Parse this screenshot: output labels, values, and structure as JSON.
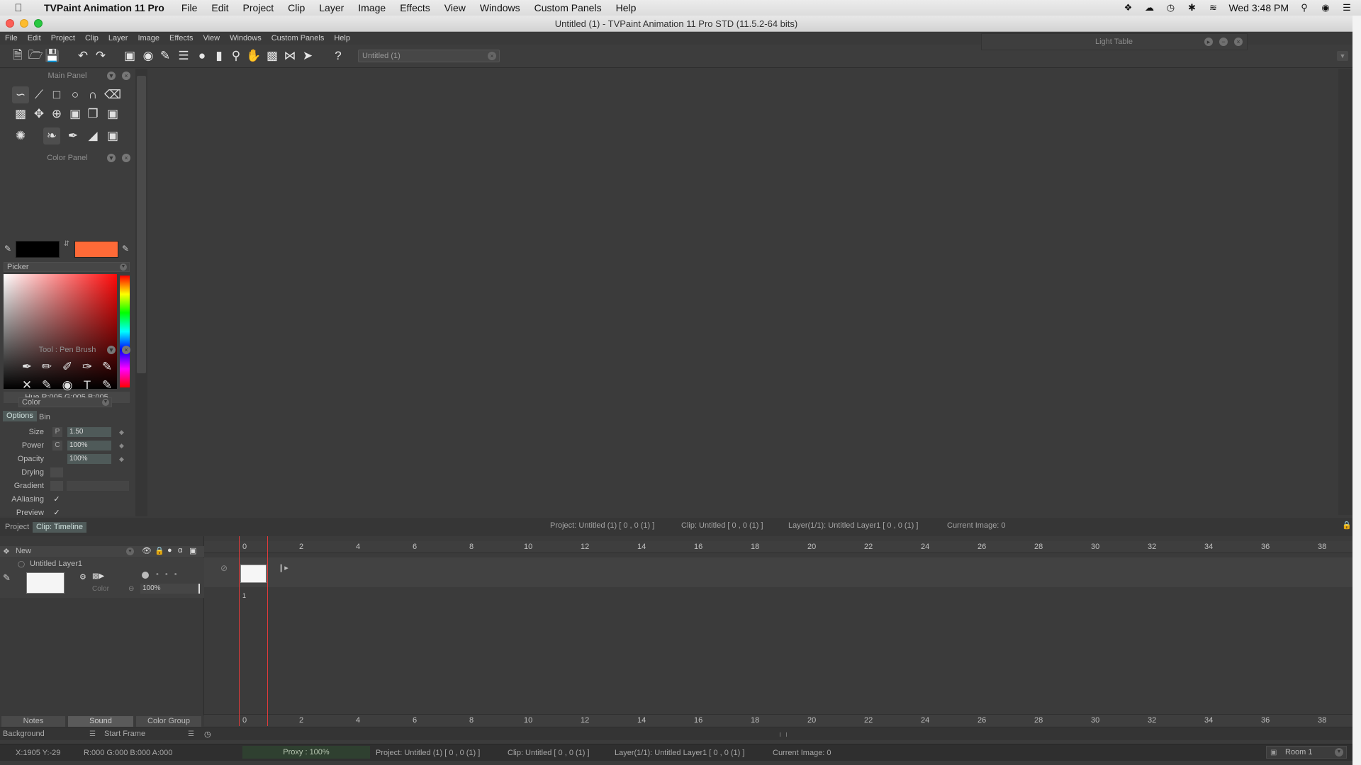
{
  "mac_menubar": {
    "app_name": "TVPaint Animation 11 Pro",
    "menus": [
      "File",
      "Edit",
      "Project",
      "Clip",
      "Layer",
      "Image",
      "Effects",
      "View",
      "Windows",
      "Custom Panels",
      "Help"
    ],
    "clock": "Wed 3:48 PM"
  },
  "window": {
    "title": "Untitled (1) - TVPaint Animation 11 Pro STD (11.5.2-64 bits)"
  },
  "app_menu": [
    "File",
    "Edit",
    "Project",
    "Clip",
    "Layer",
    "Image",
    "Effects",
    "View",
    "Windows",
    "Custom Panels",
    "Help"
  ],
  "toolbar": {
    "document": "Untitled (1)"
  },
  "light_table": {
    "title": "Light Table"
  },
  "main_panel": {
    "title": "Main Panel"
  },
  "color_panel": {
    "title": "Color Panel",
    "primary_color": "#000000",
    "secondary_color": "#ff6a37",
    "mode": "Picker",
    "readout": "Hue R:005 G:005 B:005"
  },
  "tool_panel": {
    "title": "Tool : Pen Brush",
    "mode": "Color",
    "tabs": [
      "Options",
      "Bin"
    ],
    "props": {
      "size": {
        "label": "Size",
        "letter": "P",
        "value": "1.50"
      },
      "power": {
        "label": "Power",
        "letter": "C",
        "value": "100%"
      },
      "opacity": {
        "label": "Opacity",
        "value": "100%"
      },
      "drying": {
        "label": "Drying"
      },
      "gradient": {
        "label": "Gradient"
      },
      "aaliasing": {
        "label": "AAliasing",
        "check": "✓"
      },
      "preview": {
        "label": "Preview",
        "check": "✓"
      }
    }
  },
  "infobar": {
    "tabs": [
      "Project",
      "Clip: Timeline"
    ],
    "project": "Project: Untitled (1) [ 0 , 0  (1) ]",
    "clip": "Clip: Untitled [ 0 , 0  (1) ]",
    "layer": "Layer(1/1): Untitled Layer1 [ 0 , 0  (1) ]",
    "current": "Current Image: 0"
  },
  "timeline": {
    "new_label": "New",
    "layer_name": "Untitled Layer1",
    "layer_mode": "Color",
    "layer_opacity": "100%",
    "ticks": [
      "0",
      "2",
      "4",
      "6",
      "8",
      "10",
      "12",
      "14",
      "16",
      "18",
      "20",
      "22",
      "24",
      "26",
      "28",
      "30",
      "32",
      "34",
      "36",
      "38"
    ],
    "frame_number": "1",
    "bottom_tabs": [
      "Notes",
      "Sound",
      "Color Group"
    ],
    "background_label": "Background",
    "start_frame_label": "Start Frame"
  },
  "statusbar": {
    "coords": "X:1905  Y:-29",
    "rgba": "R:000 G:000 B:000 A:000",
    "proxy": "Proxy : 100%",
    "project": "Project: Untitled (1) [ 0 , 0  (1) ]",
    "clip": "Clip: Untitled [ 0 , 0  (1) ]",
    "layer": "Layer(1/1): Untitled Layer1 [ 0 , 0  (1) ]",
    "current": "Current Image: 0",
    "room": "Room 1"
  }
}
